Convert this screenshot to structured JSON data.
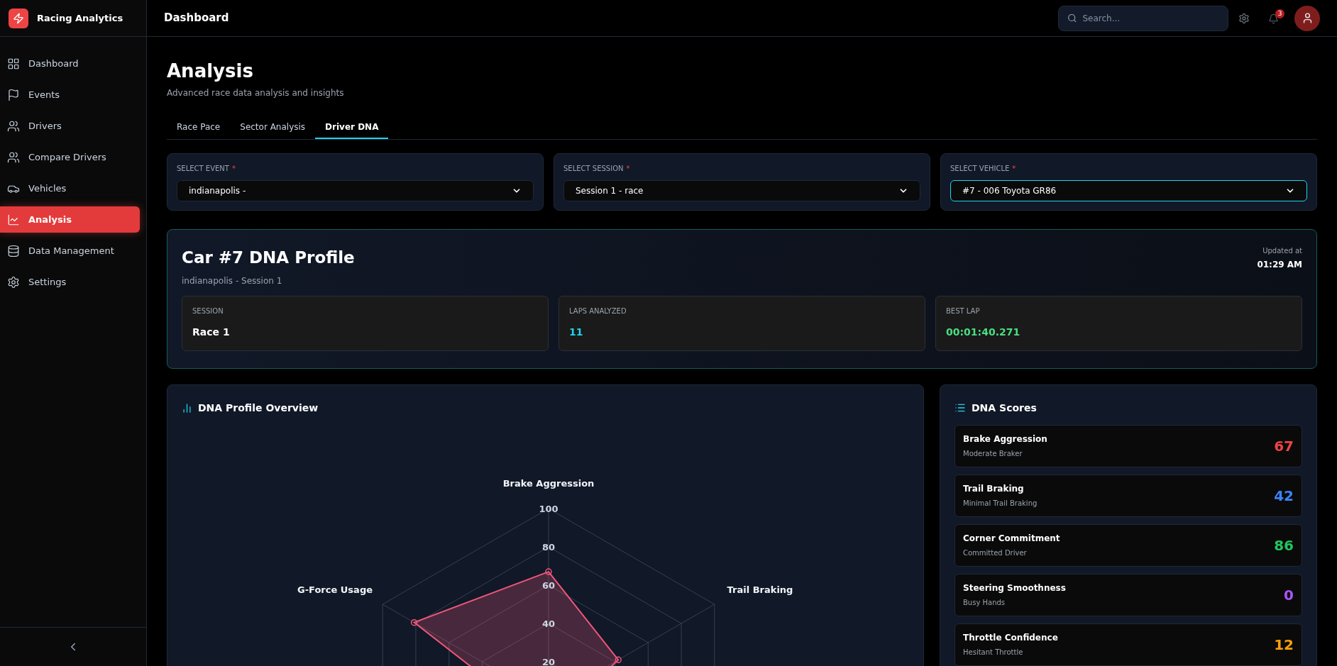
{
  "app": {
    "name": "Racing Analytics"
  },
  "sidebar": {
    "items": [
      {
        "label": "Dashboard",
        "selected": false
      },
      {
        "label": "Events",
        "selected": false
      },
      {
        "label": "Drivers",
        "selected": false
      },
      {
        "label": "Compare Drivers",
        "selected": false
      },
      {
        "label": "Vehicles",
        "selected": false
      },
      {
        "label": "Analysis",
        "selected": true
      },
      {
        "label": "Data Management",
        "selected": false
      },
      {
        "label": "Settings",
        "selected": false
      }
    ]
  },
  "topbar": {
    "title": "Dashboard",
    "search": {
      "placeholder": "Search..."
    },
    "notifications": "3"
  },
  "page": {
    "title": "Analysis",
    "subtitle": "Advanced race data analysis and insights"
  },
  "tabs": [
    {
      "label": "Race Pace",
      "selected": false
    },
    {
      "label": "Sector Analysis",
      "selected": false
    },
    {
      "label": "Driver DNA",
      "selected": true
    }
  ],
  "selectors": [
    {
      "label": "SELECT EVENT",
      "required": "*",
      "value": "indianapolis -",
      "focused": false
    },
    {
      "label": "SELECT SESSION",
      "required": "*",
      "value": "Session 1 - race",
      "focused": false
    },
    {
      "label": "SELECT VEHICLE",
      "required": "*",
      "value": "#7 - 006 Toyota GR86",
      "focused": true
    }
  ],
  "profile": {
    "title": "Car #7 DNA Profile",
    "subtitle": "indianapolis - Session 1",
    "updated_label": "Updated at",
    "updated_time": "01:29 AM",
    "stats": [
      {
        "label": "SESSION",
        "value": "Race 1",
        "color": "#ffffff"
      },
      {
        "label": "LAPS ANALYZED",
        "value": "11",
        "color": "#22d3ee"
      },
      {
        "label": "BEST LAP",
        "value": "00:01:40.271",
        "color": "#4ade80"
      }
    ]
  },
  "overview": {
    "title": "DNA Profile Overview",
    "radar": {
      "axis_labels": [
        "Brake Aggression",
        "G-Force Usage",
        "Trail Braking"
      ],
      "tick_labels": [
        "100",
        "80",
        "60",
        "40",
        "20"
      ]
    }
  },
  "scores": {
    "title": "DNA Scores",
    "items": [
      {
        "name": "Brake Aggression",
        "description": "Moderate Braker",
        "score": "67",
        "color": "#ef4444"
      },
      {
        "name": "Trail Braking",
        "description": "Minimal Trail Braking",
        "score": "42",
        "color": "#3b82f6"
      },
      {
        "name": "Corner Commitment",
        "description": "Committed Driver",
        "score": "86",
        "color": "#22c55e"
      },
      {
        "name": "Steering Smoothness",
        "description": "Busy Hands",
        "score": "0",
        "color": "#a855f7"
      },
      {
        "name": "Throttle Confidence",
        "description": "Hesitant Throttle",
        "score": "12",
        "color": "#f59e0b"
      }
    ]
  }
}
